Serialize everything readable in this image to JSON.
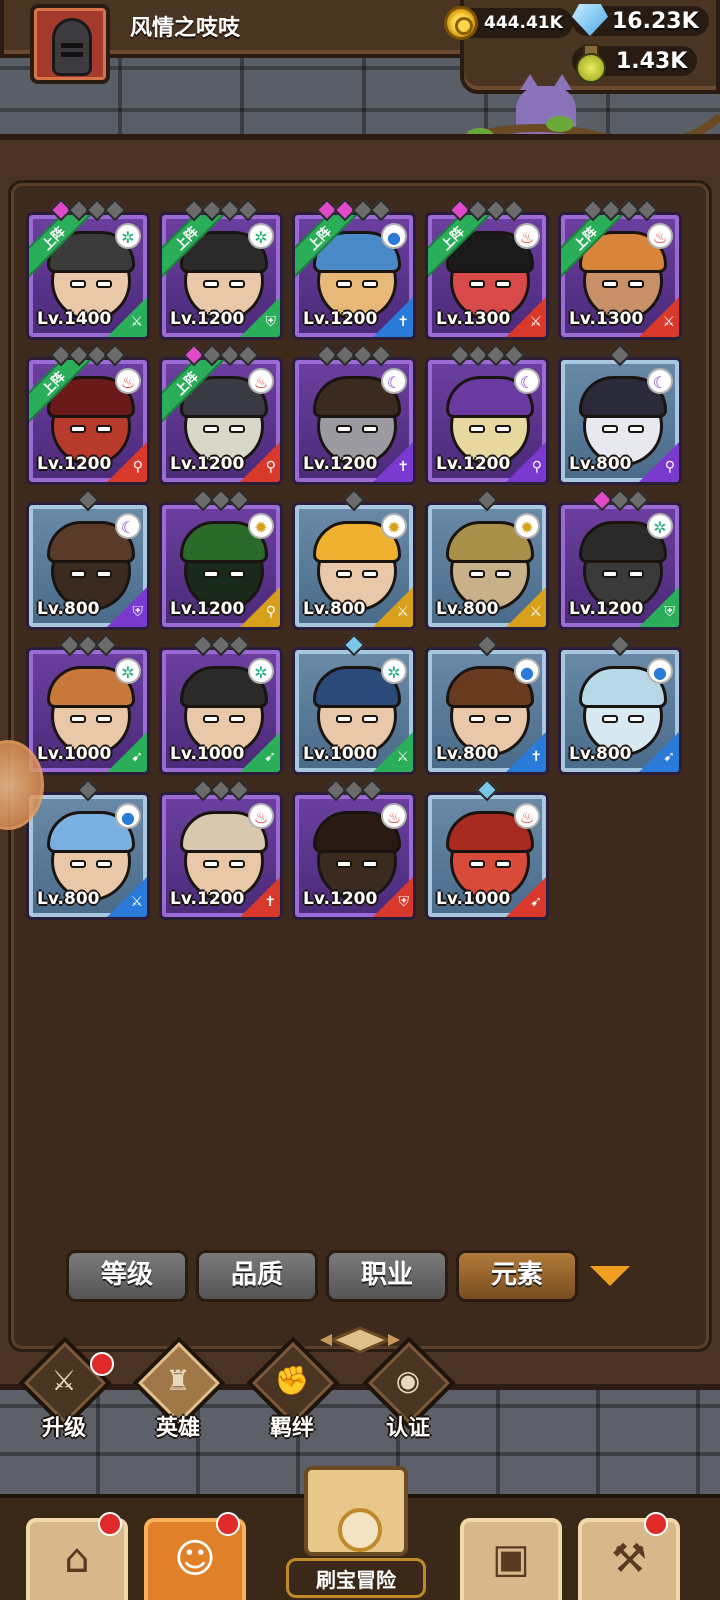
{
  "player": {
    "name": "风情之吱吱"
  },
  "resources": {
    "gold": "444.41K",
    "gems": "16.23K",
    "potion": "1.43K"
  },
  "heroes": [
    {
      "level": "Lv.1400",
      "deployed": true,
      "element": "wind",
      "class": "sword",
      "rarity": "purple",
      "skin": "#e8c8a8",
      "hair": "#3a3a3a",
      "stars": [
        "pink",
        "gray",
        "gray",
        "gray"
      ]
    },
    {
      "level": "Lv.1200",
      "deployed": true,
      "element": "wind",
      "class": "shield",
      "rarity": "purple",
      "skin": "#e8c8a8",
      "hair": "#2a2a2a",
      "stars": [
        "gray",
        "gray",
        "gray",
        "gray"
      ]
    },
    {
      "level": "Lv.1200",
      "deployed": true,
      "element": "water",
      "class": "lance",
      "rarity": "purple",
      "skin": "#e8b878",
      "hair": "#4a8ac8",
      "stars": [
        "pink",
        "pink",
        "gray",
        "gray"
      ]
    },
    {
      "level": "Lv.1300",
      "deployed": true,
      "element": "fire",
      "class": "sword",
      "rarity": "purple",
      "skin": "#d84a4a",
      "hair": "#1a1a1a",
      "stars": [
        "pink",
        "gray",
        "gray",
        "gray"
      ]
    },
    {
      "level": "Lv.1300",
      "deployed": true,
      "element": "fire",
      "class": "sword",
      "rarity": "purple",
      "skin": "#c89068",
      "hair": "#d8843a",
      "stars": [
        "gray",
        "gray",
        "gray",
        "gray"
      ]
    },
    {
      "level": "Lv.1200",
      "deployed": true,
      "element": "fire",
      "class": "staff",
      "rarity": "purple",
      "skin": "#b83a2a",
      "hair": "#6a1a1a",
      "stars": [
        "gray",
        "gray",
        "gray",
        "gray"
      ]
    },
    {
      "level": "Lv.1200",
      "deployed": true,
      "element": "fire",
      "class": "staff",
      "rarity": "purple",
      "skin": "#d8d8c8",
      "hair": "#3a3a44",
      "stars": [
        "pink",
        "gray",
        "gray",
        "gray"
      ]
    },
    {
      "level": "Lv.1200",
      "deployed": false,
      "element": "dark",
      "class": "lance",
      "rarity": "purple",
      "skin": "#9a9aa0",
      "hair": "#3a2a20",
      "stars": [
        "gray",
        "gray",
        "gray",
        "gray"
      ]
    },
    {
      "level": "Lv.1200",
      "deployed": false,
      "element": "dark",
      "class": "staff",
      "rarity": "purple",
      "skin": "#e8d8a0",
      "hair": "#6a3aa0",
      "stars": [
        "gray",
        "gray",
        "gray",
        "gray"
      ]
    },
    {
      "level": "Lv.800",
      "deployed": false,
      "element": "dark",
      "class": "staff",
      "rarity": "blue",
      "skin": "#e8e8f0",
      "hair": "#2a2a3a",
      "stars": [
        "gray"
      ]
    },
    {
      "level": "Lv.800",
      "deployed": false,
      "element": "dark",
      "class": "shield",
      "rarity": "blue",
      "skin": "#3a2a20",
      "hair": "#5a3a28",
      "stars": [
        "gray"
      ]
    },
    {
      "level": "Lv.1200",
      "deployed": false,
      "element": "light",
      "class": "staff",
      "rarity": "purple",
      "skin": "#1a2a1a",
      "hair": "#2a6a2a",
      "stars": [
        "gray",
        "gray",
        "gray"
      ]
    },
    {
      "level": "Lv.800",
      "deployed": false,
      "element": "light",
      "class": "sword",
      "rarity": "blue",
      "skin": "#e8c8a8",
      "hair": "#f0b030",
      "stars": [
        "gray"
      ]
    },
    {
      "level": "Lv.800",
      "deployed": false,
      "element": "light",
      "class": "sword",
      "rarity": "blue",
      "skin": "#c8b088",
      "hair": "#a8904a",
      "stars": [
        "gray"
      ]
    },
    {
      "level": "Lv.1200",
      "deployed": false,
      "element": "wind",
      "class": "shield",
      "rarity": "purple",
      "skin": "#3a3a3a",
      "hair": "#2a2a2a",
      "stars": [
        "pink",
        "gray",
        "gray"
      ]
    },
    {
      "level": "Lv.1000",
      "deployed": false,
      "element": "wind",
      "class": "bow",
      "rarity": "purple",
      "skin": "#e8c8a8",
      "hair": "#c8783a",
      "stars": [
        "gray",
        "gray",
        "gray"
      ]
    },
    {
      "level": "Lv.1000",
      "deployed": false,
      "element": "wind",
      "class": "bow",
      "rarity": "purple",
      "skin": "#e8c8a8",
      "hair": "#2a2a2a",
      "stars": [
        "gray",
        "gray",
        "gray"
      ]
    },
    {
      "level": "Lv.1000",
      "deployed": false,
      "element": "wind",
      "class": "sword",
      "rarity": "blue",
      "skin": "#e8c8a8",
      "hair": "#2a4a7a",
      "stars": [
        "blue"
      ]
    },
    {
      "level": "Lv.800",
      "deployed": false,
      "element": "water",
      "class": "lance",
      "rarity": "blue",
      "skin": "#e8c8a8",
      "hair": "#6a3a20",
      "stars": [
        "gray"
      ]
    },
    {
      "level": "Lv.800",
      "deployed": false,
      "element": "water",
      "class": "bow",
      "rarity": "blue",
      "skin": "#d8e8f0",
      "hair": "#b8d8e8",
      "stars": [
        "gray"
      ]
    },
    {
      "level": "Lv.800",
      "deployed": false,
      "element": "water",
      "class": "sword",
      "rarity": "blue",
      "skin": "#e8c8a8",
      "hair": "#7ab0e0",
      "stars": [
        "gray"
      ]
    },
    {
      "level": "Lv.1200",
      "deployed": false,
      "element": "fire",
      "class": "lance",
      "rarity": "purple",
      "skin": "#e8c8a8",
      "hair": "#d8c8b0",
      "stars": [
        "gray",
        "gray",
        "gray"
      ]
    },
    {
      "level": "Lv.1200",
      "deployed": false,
      "element": "fire",
      "class": "shield",
      "rarity": "purple",
      "skin": "#3a2a20",
      "hair": "#2a1a14",
      "stars": [
        "gray",
        "gray",
        "gray"
      ]
    },
    {
      "level": "Lv.1000",
      "deployed": false,
      "element": "fire",
      "class": "bow",
      "rarity": "blue",
      "skin": "#d84a3a",
      "hair": "#a82a20",
      "stars": [
        "blue"
      ]
    }
  ],
  "deployed_label": "上阵",
  "element_glyphs": {
    "wind": "✲",
    "fire": "♨",
    "water": "●",
    "dark": "☾",
    "light": "✹"
  },
  "class_glyphs": {
    "sword": "⚔",
    "shield": "⛨",
    "lance": "✝",
    "staff": "⚲",
    "bow": "➹"
  },
  "filter_tabs": [
    {
      "label": "等级",
      "active": false
    },
    {
      "label": "品质",
      "active": false
    },
    {
      "label": "职业",
      "active": false
    },
    {
      "label": "元素",
      "active": true
    }
  ],
  "subnav": [
    {
      "label": "升级",
      "icon": "sword-icon",
      "glyph": "⚔",
      "active": false,
      "badge": true
    },
    {
      "label": "英雄",
      "icon": "hero-icon",
      "glyph": "♜",
      "active": true,
      "badge": false
    },
    {
      "label": "羁绊",
      "icon": "handshake-icon",
      "glyph": "✊",
      "active": false,
      "badge": false
    },
    {
      "label": "认证",
      "icon": "eye-icon",
      "glyph": "◉",
      "active": false,
      "badge": false
    }
  ],
  "bottom_nav": [
    {
      "name": "shop",
      "icon": "shop-icon",
      "glyph": "⌂",
      "active": false,
      "badge": true
    },
    {
      "name": "heroes",
      "icon": "hero-avatar-icon",
      "glyph": "☺",
      "active": true,
      "badge": true
    },
    {
      "name": "inventory",
      "icon": "backpack-icon",
      "glyph": "▣",
      "active": false,
      "badge": false
    },
    {
      "name": "forge",
      "icon": "hammer-icon",
      "glyph": "⚒",
      "active": false,
      "badge": true
    }
  ],
  "adventure_label": "刷宝冒险"
}
